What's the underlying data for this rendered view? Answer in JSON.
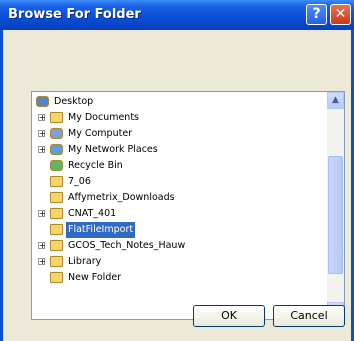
{
  "window": {
    "title": "Browse For Folder",
    "help": "?",
    "close": "✕"
  },
  "tree": {
    "items": [
      {
        "label": "Desktop",
        "icon": "desktop-icon",
        "level": 0,
        "expander": false,
        "selected": false
      },
      {
        "label": "My Documents",
        "icon": "documents-folder-icon",
        "level": 1,
        "expander": true,
        "selected": false
      },
      {
        "label": "My Computer",
        "icon": "computer-icon",
        "level": 1,
        "expander": true,
        "selected": false
      },
      {
        "label": "My Network Places",
        "icon": "network-places-icon",
        "level": 1,
        "expander": true,
        "selected": false
      },
      {
        "label": "Recycle Bin",
        "icon": "recycle-bin-icon",
        "level": 1,
        "expander": false,
        "selected": false
      },
      {
        "label": "7_06",
        "icon": "folder-icon",
        "level": 1,
        "expander": false,
        "selected": false
      },
      {
        "label": "Affymetrix_Downloads",
        "icon": "folder-icon",
        "level": 1,
        "expander": false,
        "selected": false
      },
      {
        "label": "CNAT_401",
        "icon": "folder-icon",
        "level": 1,
        "expander": true,
        "selected": false
      },
      {
        "label": "FlatFileImport",
        "icon": "folder-icon",
        "level": 1,
        "expander": false,
        "selected": true
      },
      {
        "label": "GCOS_Tech_Notes_Hauw",
        "icon": "folder-icon",
        "level": 1,
        "expander": true,
        "selected": false
      },
      {
        "label": "Library",
        "icon": "folder-icon",
        "level": 1,
        "expander": true,
        "selected": false
      },
      {
        "label": "New Folder",
        "icon": "folder-icon",
        "level": 1,
        "expander": false,
        "selected": false
      }
    ]
  },
  "buttons": {
    "ok": "OK",
    "cancel": "Cancel"
  },
  "scrollbar": {
    "up": "▲",
    "down": "▼"
  },
  "colors": {
    "titlebar": "#0a4fd8",
    "selection": "#316ac5",
    "dialog": "#ece9d8"
  }
}
